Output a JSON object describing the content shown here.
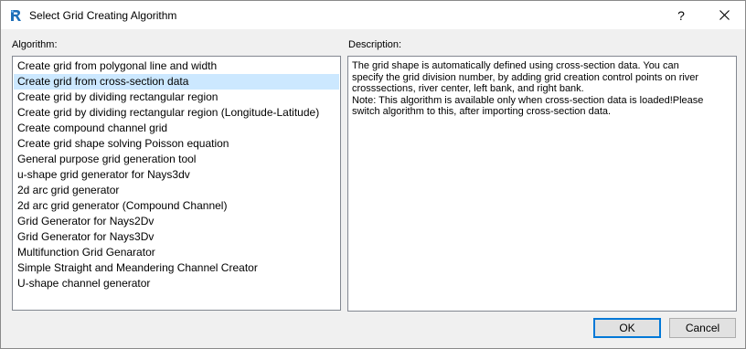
{
  "window": {
    "title": "Select Grid Creating Algorithm",
    "help_label": "?",
    "close_label": "✕"
  },
  "algorithm": {
    "label": "Algorithm:",
    "items": [
      "Create grid from polygonal line and width",
      "Create grid from cross-section data",
      "Create grid by dividing rectangular region",
      "Create grid by dividing rectangular region (Longitude-Latitude)",
      "Create compound channel grid",
      "Create grid shape solving Poisson equation",
      "General purpose grid generation tool",
      "u-shape grid generator for Nays3dv",
      "2d arc grid generator",
      "2d arc grid generator (Compound Channel)",
      "Grid Generator for Nays2Dv",
      "Grid Generator for Nays3Dv",
      "Multifunction Grid Genarator",
      "Simple Straight and Meandering Channel Creator",
      "U-shape channel generator"
    ],
    "selected_index": 1
  },
  "description": {
    "label": "Description:",
    "lines": [
      "The grid shape is automatically defined using cross-section data. You can",
      "specify the grid division number, by adding grid creation control points on river",
      "crosssections, river center, left bank, and right bank.",
      "Note: This algorithm is available only when cross-section data is loaded!Please",
      "switch algorithm to this, after importing cross-section data."
    ]
  },
  "buttons": {
    "ok": "OK",
    "cancel": "Cancel"
  },
  "colors": {
    "selection": "#cce8ff",
    "focus_border": "#0078d7",
    "icon_blue": "#1e6fb8"
  }
}
